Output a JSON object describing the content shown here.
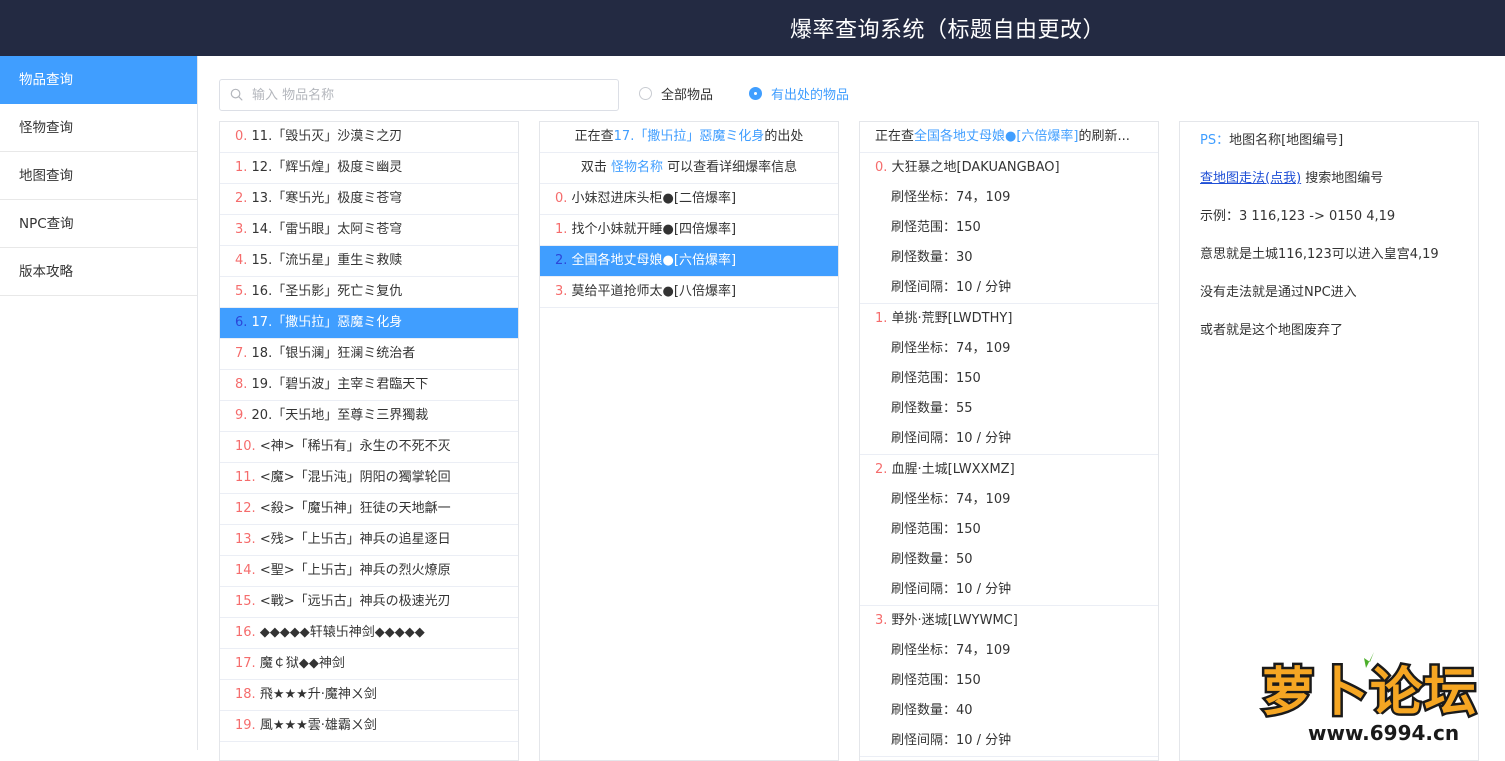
{
  "header": {
    "title": "爆率查询系统（标题自由更改）"
  },
  "sidebar": {
    "items": [
      {
        "label": "物品查询",
        "active": true
      },
      {
        "label": "怪物查询",
        "active": false
      },
      {
        "label": "地图查询",
        "active": false
      },
      {
        "label": "NPC查询",
        "active": false
      },
      {
        "label": "版本攻略",
        "active": false
      }
    ]
  },
  "search": {
    "placeholder": "输入 物品名称",
    "value": ""
  },
  "filters": {
    "all": {
      "label": "全部物品",
      "checked": false
    },
    "has_source": {
      "label": "有出处的物品",
      "checked": true
    }
  },
  "items": [
    {
      "index": "0.",
      "name": " 11.「毁卐灭」沙漠ミ之刃"
    },
    {
      "index": "1.",
      "name": " 12.「辉卐煌」极度ミ幽灵"
    },
    {
      "index": "2.",
      "name": " 13.「寒卐光」极度ミ苍穹"
    },
    {
      "index": "3.",
      "name": " 14.「雷卐眼」太阿ミ苍穹"
    },
    {
      "index": "4.",
      "name": " 15.「流卐星」重生ミ救赎"
    },
    {
      "index": "5.",
      "name": " 16.「圣卐影」死亡ミ复仇"
    },
    {
      "index": "6.",
      "name": " 17.「撒卐拉」惡魔ミ化身",
      "active": true
    },
    {
      "index": "7.",
      "name": " 18.「银卐澜」狂澜ミ统治者"
    },
    {
      "index": "8.",
      "name": " 19.「碧卐波」主宰ミ君臨天下"
    },
    {
      "index": "9.",
      "name": " 20.「天卐地」至尊ミ三界獨裁"
    },
    {
      "index": "10.",
      "name": " <神>「稀卐有」永生の不死不灭"
    },
    {
      "index": "11.",
      "name": " <魔>「混卐沌」阴阳の獨掌轮回"
    },
    {
      "index": "12.",
      "name": " <殺>「魔卐神」狂徒の天地龢一"
    },
    {
      "index": "13.",
      "name": " <残>「上卐古」神兵の追星逐日"
    },
    {
      "index": "14.",
      "name": " <聖>「上卐古」神兵の烈火燎原"
    },
    {
      "index": "15.",
      "name": " <戰>「远卐古」神兵の极速光刃"
    },
    {
      "index": "16.",
      "name": " ◆◆◆◆◆轩辕卐神剑◆◆◆◆◆"
    },
    {
      "index": "17.",
      "name": " 魔￠狱◆◆神剑"
    },
    {
      "index": "18.",
      "name": " 飛★★★升·魔神ㄨ剑"
    },
    {
      "index": "19.",
      "name": " 風★★★雲·雄霸ㄨ剑"
    }
  ],
  "monster_panel": {
    "header_prefix": "正在查",
    "header_item": "17.「撒卐拉」惡魔ミ化身",
    "header_suffix": "的出处",
    "hint_prefix": "双击 ",
    "hint_link": "怪物名称",
    "hint_suffix": " 可以查看详细爆率信息",
    "rows": [
      {
        "index": "0.",
        "name": " 小妹怼进床头柜●[二倍爆率]"
      },
      {
        "index": "1.",
        "name": " 找个小妹就开睡●[四倍爆率]"
      },
      {
        "index": "2.",
        "name": " 全国各地丈母娘●[六倍爆率]",
        "active": true
      },
      {
        "index": "3.",
        "name": " 莫给平道抢师太●[八倍爆率]"
      }
    ]
  },
  "map_panel": {
    "header_prefix": "正在查",
    "header_item": "全国各地丈母娘●[六倍爆率]",
    "header_suffix": "的刷新...",
    "maps": [
      {
        "index": "0.",
        "name": " 大狂暴之地[DAKUANGBAO]",
        "lines": [
          "刷怪坐标：74，109",
          "刷怪范围：150",
          "刷怪数量：30",
          "刷怪间隔：10 / 分钟"
        ]
      },
      {
        "index": "1.",
        "name": " 单挑·荒野[LWDTHY]",
        "lines": [
          "刷怪坐标：74，109",
          "刷怪范围：150",
          "刷怪数量：55",
          "刷怪间隔：10 / 分钟"
        ]
      },
      {
        "index": "2.",
        "name": " 血腥·土城[LWXXMZ]",
        "lines": [
          "刷怪坐标：74，109",
          "刷怪范围：150",
          "刷怪数量：50",
          "刷怪间隔：10 / 分钟"
        ]
      },
      {
        "index": "3.",
        "name": " 野外·迷城[LWYWMC]",
        "lines": [
          "刷怪坐标：74，109",
          "刷怪范围：150",
          "刷怪数量：40",
          "刷怪间隔：10 / 分钟"
        ]
      }
    ]
  },
  "ps_panel": {
    "ps_label": "PS：",
    "ps_text": "地图名称[地图编号]",
    "link_text": "查地图走法(点我)",
    "link_suffix": " 搜索地图编号",
    "example": "示例：3 116,123 -> 0150 4,19",
    "meaning": "意思就是土城116,123可以进入皇宫4,19",
    "no_path": "没有走法就是通过NPC进入",
    "abandoned": "或者就是这个地图废弃了"
  },
  "watermark": {
    "brand": "萝卜论坛",
    "site": "www.6994.cn"
  },
  "colors": {
    "header_bg": "#232a42",
    "accent": "#409eff",
    "index_red": "#f56c6c",
    "link_blue": "#1f4fd6"
  }
}
